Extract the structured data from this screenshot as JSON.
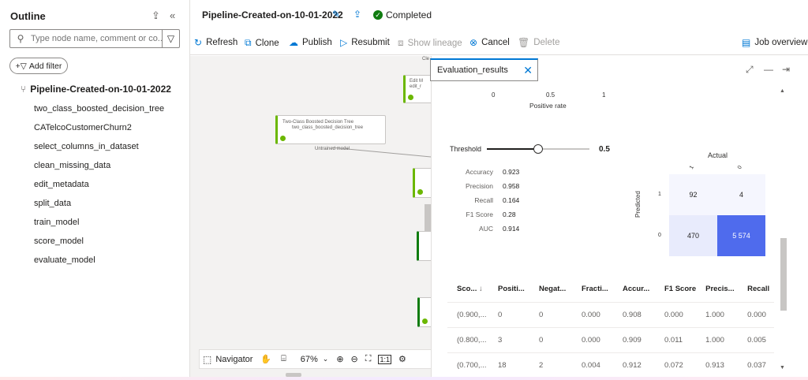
{
  "outline": {
    "title": "Outline",
    "search_placeholder": "Type node name, comment or co...",
    "add_filter": "Add filter",
    "root": "Pipeline-Created-on-10-01-2022",
    "items": [
      "two_class_boosted_decision_tree",
      "CATelcoCustomerChurn2",
      "select_columns_in_dataset",
      "clean_missing_data",
      "edit_metadata",
      "split_data",
      "train_model",
      "score_model",
      "evaluate_model"
    ]
  },
  "header": {
    "pipeline_title": "Pipeline-Created-on-10-01-2022",
    "status": "Completed"
  },
  "toolbar": {
    "refresh": "Refresh",
    "clone": "Clone",
    "publish": "Publish",
    "resubmit": "Resubmit",
    "show_lineage": "Show lineage",
    "cancel": "Cancel",
    "delete": "Delete",
    "job_overview": "Job overview"
  },
  "canvas": {
    "node_boosted_title": "Two-Class Boosted Decision Tree",
    "node_boosted_sub": "two_class_boosted_decision_tree",
    "port_label": "Untrained model",
    "node_edit_title": "Edit M",
    "node_edit_sub": "edit_r",
    "node_top_label": "Cle",
    "navigator": "Navigator",
    "zoom": "67%"
  },
  "evaluation": {
    "tab_title": "Evaluation_results",
    "axis_ticks": [
      "0",
      "0.5",
      "1"
    ],
    "positive_rate_label": "Positive rate",
    "threshold_label": "Threshold",
    "threshold_value": "0.5",
    "threshold_fraction": 0.5,
    "metrics": [
      {
        "name": "Accuracy",
        "value": "0.923"
      },
      {
        "name": "Precision",
        "value": "0.958"
      },
      {
        "name": "Recall",
        "value": "0.164"
      },
      {
        "name": "F1 Score",
        "value": "0.28"
      },
      {
        "name": "AUC",
        "value": "0.914"
      }
    ],
    "confusion": {
      "title": "Actual",
      "predicted_label": "Predicted",
      "actual_ticks": [
        "1",
        "0"
      ],
      "predicted_ticks": [
        "1",
        "0"
      ],
      "cells": [
        [
          "92",
          "4"
        ],
        [
          "470",
          "5 574"
        ]
      ]
    },
    "table": {
      "columns": [
        "Sco...",
        "Positi...",
        "Negat...",
        "Fracti...",
        "Accur...",
        "F1 Score",
        "Precis...",
        "Recall"
      ],
      "rows": [
        [
          "(0.900,...",
          "0",
          "0",
          "0.000",
          "0.908",
          "0.000",
          "1.000",
          "0.000"
        ],
        [
          "(0.800,...",
          "3",
          "0",
          "0.000",
          "0.909",
          "0.011",
          "1.000",
          "0.005"
        ],
        [
          "(0.700,...",
          "18",
          "2",
          "0.004",
          "0.912",
          "0.072",
          "0.913",
          "0.037"
        ]
      ]
    }
  },
  "colors": {
    "accent": "#0078d4",
    "success": "#107c10",
    "cm_dark": "#4f6bed",
    "cm_light": "#e8ebfc"
  }
}
